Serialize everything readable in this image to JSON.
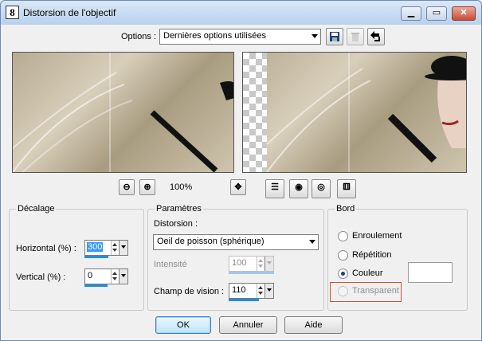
{
  "window": {
    "title": "Distorsion de l'objectif",
    "app_icon_text": "8"
  },
  "options": {
    "label": "Options :",
    "selected": "Dernières options utilisées"
  },
  "preview": {
    "zoom": "100%"
  },
  "decalage": {
    "title": "Décalage",
    "horizontal_label": "Horizontal (%) :",
    "horizontal_value": "300",
    "vertical_label": "Vertical (%) :",
    "vertical_value": "0"
  },
  "parametres": {
    "title": "Paramètres",
    "distorsion_label": "Distorsion :",
    "distorsion_selected": "Oeil de poisson (sphérique)",
    "intensite_label": "Intensité",
    "intensite_value": "100",
    "champ_label": "Champ de vision :",
    "champ_value": "110"
  },
  "bord": {
    "title": "Bord",
    "options": [
      "Enroulement",
      "Répétition",
      "Couleur",
      "Transparent"
    ],
    "selected": "Couleur"
  },
  "buttons": {
    "ok": "OK",
    "annuler": "Annuler",
    "aide": "Aide"
  }
}
